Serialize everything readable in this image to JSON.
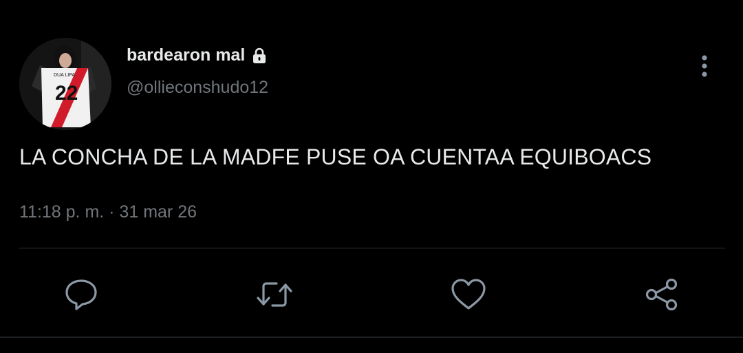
{
  "tweet": {
    "display_name": "bardearon mal",
    "handle": "@ollieconshudo12",
    "text": "LA CONCHA DE LA MADFE PUSE OA CUENTAA EQUIBOACS",
    "timestamp": "11:18 p. m. · 31 mar 26",
    "avatar_jersey_text": "DUA LIPA",
    "avatar_jersey_number": "22",
    "protected_icon": "lock-icon"
  },
  "actions": {
    "reply_icon": "reply-icon",
    "retweet_icon": "retweet-icon",
    "like_icon": "heart-icon",
    "share_icon": "share-icon",
    "more_icon": "more-vertical-icon"
  },
  "colors": {
    "background": "#000000",
    "primary_text": "#e7e9ea",
    "secondary_text": "#71767b",
    "icon": "#8b98a5",
    "divider": "#2f3336"
  }
}
